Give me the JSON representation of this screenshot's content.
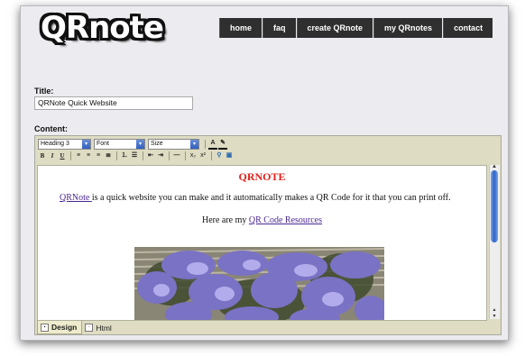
{
  "app": {
    "logo_text": "QRnote"
  },
  "nav": [
    "home",
    "faq",
    "create QRnote",
    "my QRnotes",
    "contact"
  ],
  "form": {
    "title_label": "Title:",
    "title_value": "QRNote Quick Website",
    "content_label": "Content:"
  },
  "toolbar": {
    "format_select": "Heading 3",
    "font_select": "Font",
    "size_select": "Size",
    "bold": "B",
    "italic": "I",
    "underline": "U",
    "subscript": "x₂",
    "superscript": "x²"
  },
  "content": {
    "heading": "QRNOTE",
    "para1_link": "QRNote ",
    "para1_text": "is a quick website you can make and it automatically makes a QR Code for it that you can print off.",
    "para2_text": "Here are my ",
    "para2_link": "QR Code Resources"
  },
  "tabs": {
    "design": "Design",
    "html": "Html",
    "active": "Design"
  },
  "colors": {
    "heading": "#e0201a",
    "link": "#4b2790",
    "nav_bg": "#2f2f2f",
    "toolbar_bg": "#dedcc2"
  }
}
